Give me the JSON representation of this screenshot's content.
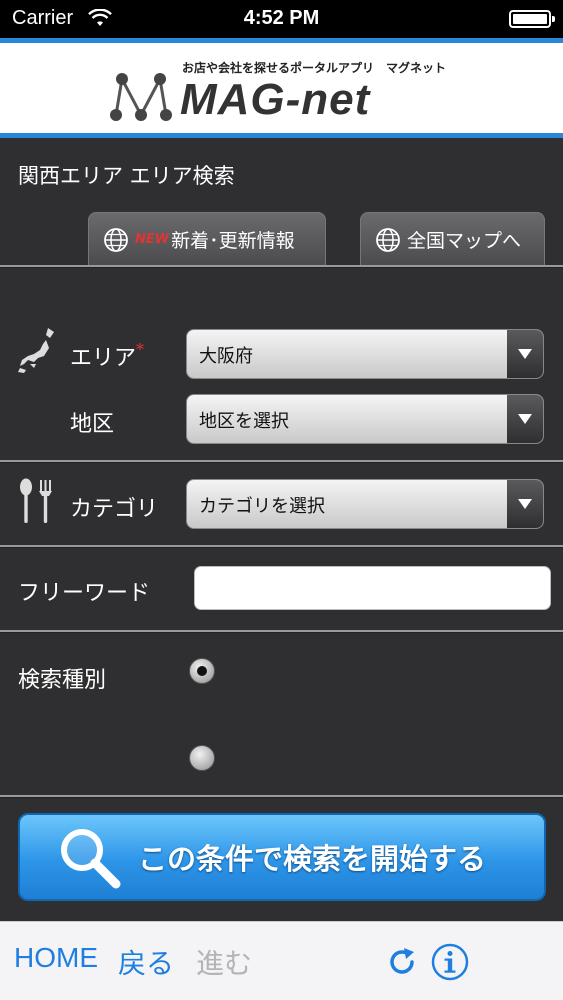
{
  "status_bar": {
    "carrier": "Carrier",
    "time": "4:52 PM"
  },
  "header": {
    "tagline": "お店や会社を探せるポータルアプリ　マグネット",
    "logo_text": "MAG-net",
    "accent_color": "#2a86d6"
  },
  "page_title": "関西エリア エリア検索",
  "tabs": [
    {
      "badge": "NEW",
      "label": "新着･更新情報",
      "icon": "globe-icon"
    },
    {
      "label": "全国マップへ",
      "icon": "globe-icon"
    }
  ],
  "form": {
    "area": {
      "label": "エリア",
      "required_mark": "*",
      "value": "大阪府",
      "icon": "japan-map-icon"
    },
    "district": {
      "label": "地区",
      "value": "地区を選択"
    },
    "category": {
      "label": "カテゴリ",
      "value": "カテゴリを選択",
      "icon": "fork-spoon-icon"
    },
    "freeword": {
      "label": "フリーワード",
      "value": ""
    },
    "search_type": {
      "label": "検索種別",
      "options_selected": [
        true,
        false
      ]
    }
  },
  "search_button": {
    "label": "この条件で検索を開始する",
    "icon": "magnifier-icon"
  },
  "toolbar": {
    "home": "HOME",
    "back": "戻る",
    "forward": "進む",
    "reload_icon": "reload-icon",
    "info_icon": "info-icon"
  }
}
